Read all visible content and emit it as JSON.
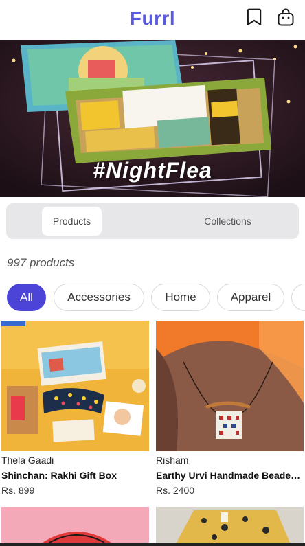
{
  "header": {
    "brand": "Furrl",
    "bookmark_icon": "bookmark-icon",
    "bag_icon": "shopping-bag-icon"
  },
  "banner": {
    "caption": "#NightFlea"
  },
  "tabs": [
    {
      "label": "Products",
      "active": true
    },
    {
      "label": "Collections",
      "active": false
    }
  ],
  "product_count": "997 products",
  "filters": [
    {
      "label": "All",
      "active": true
    },
    {
      "label": "Accessories",
      "active": false
    },
    {
      "label": "Home",
      "active": false
    },
    {
      "label": "Apparel",
      "active": false
    }
  ],
  "products": [
    {
      "vendor": "Thela Gaadi",
      "name": "Shinchan: Rakhi Gift Box",
      "price": "Rs. 899"
    },
    {
      "vendor": "Risham",
      "name": "Earthy Urvi Handmade Beaded Necklace",
      "price": "Rs. 2400"
    }
  ],
  "colors": {
    "brand": "#5b5be0",
    "accent": "#4c44d6"
  }
}
